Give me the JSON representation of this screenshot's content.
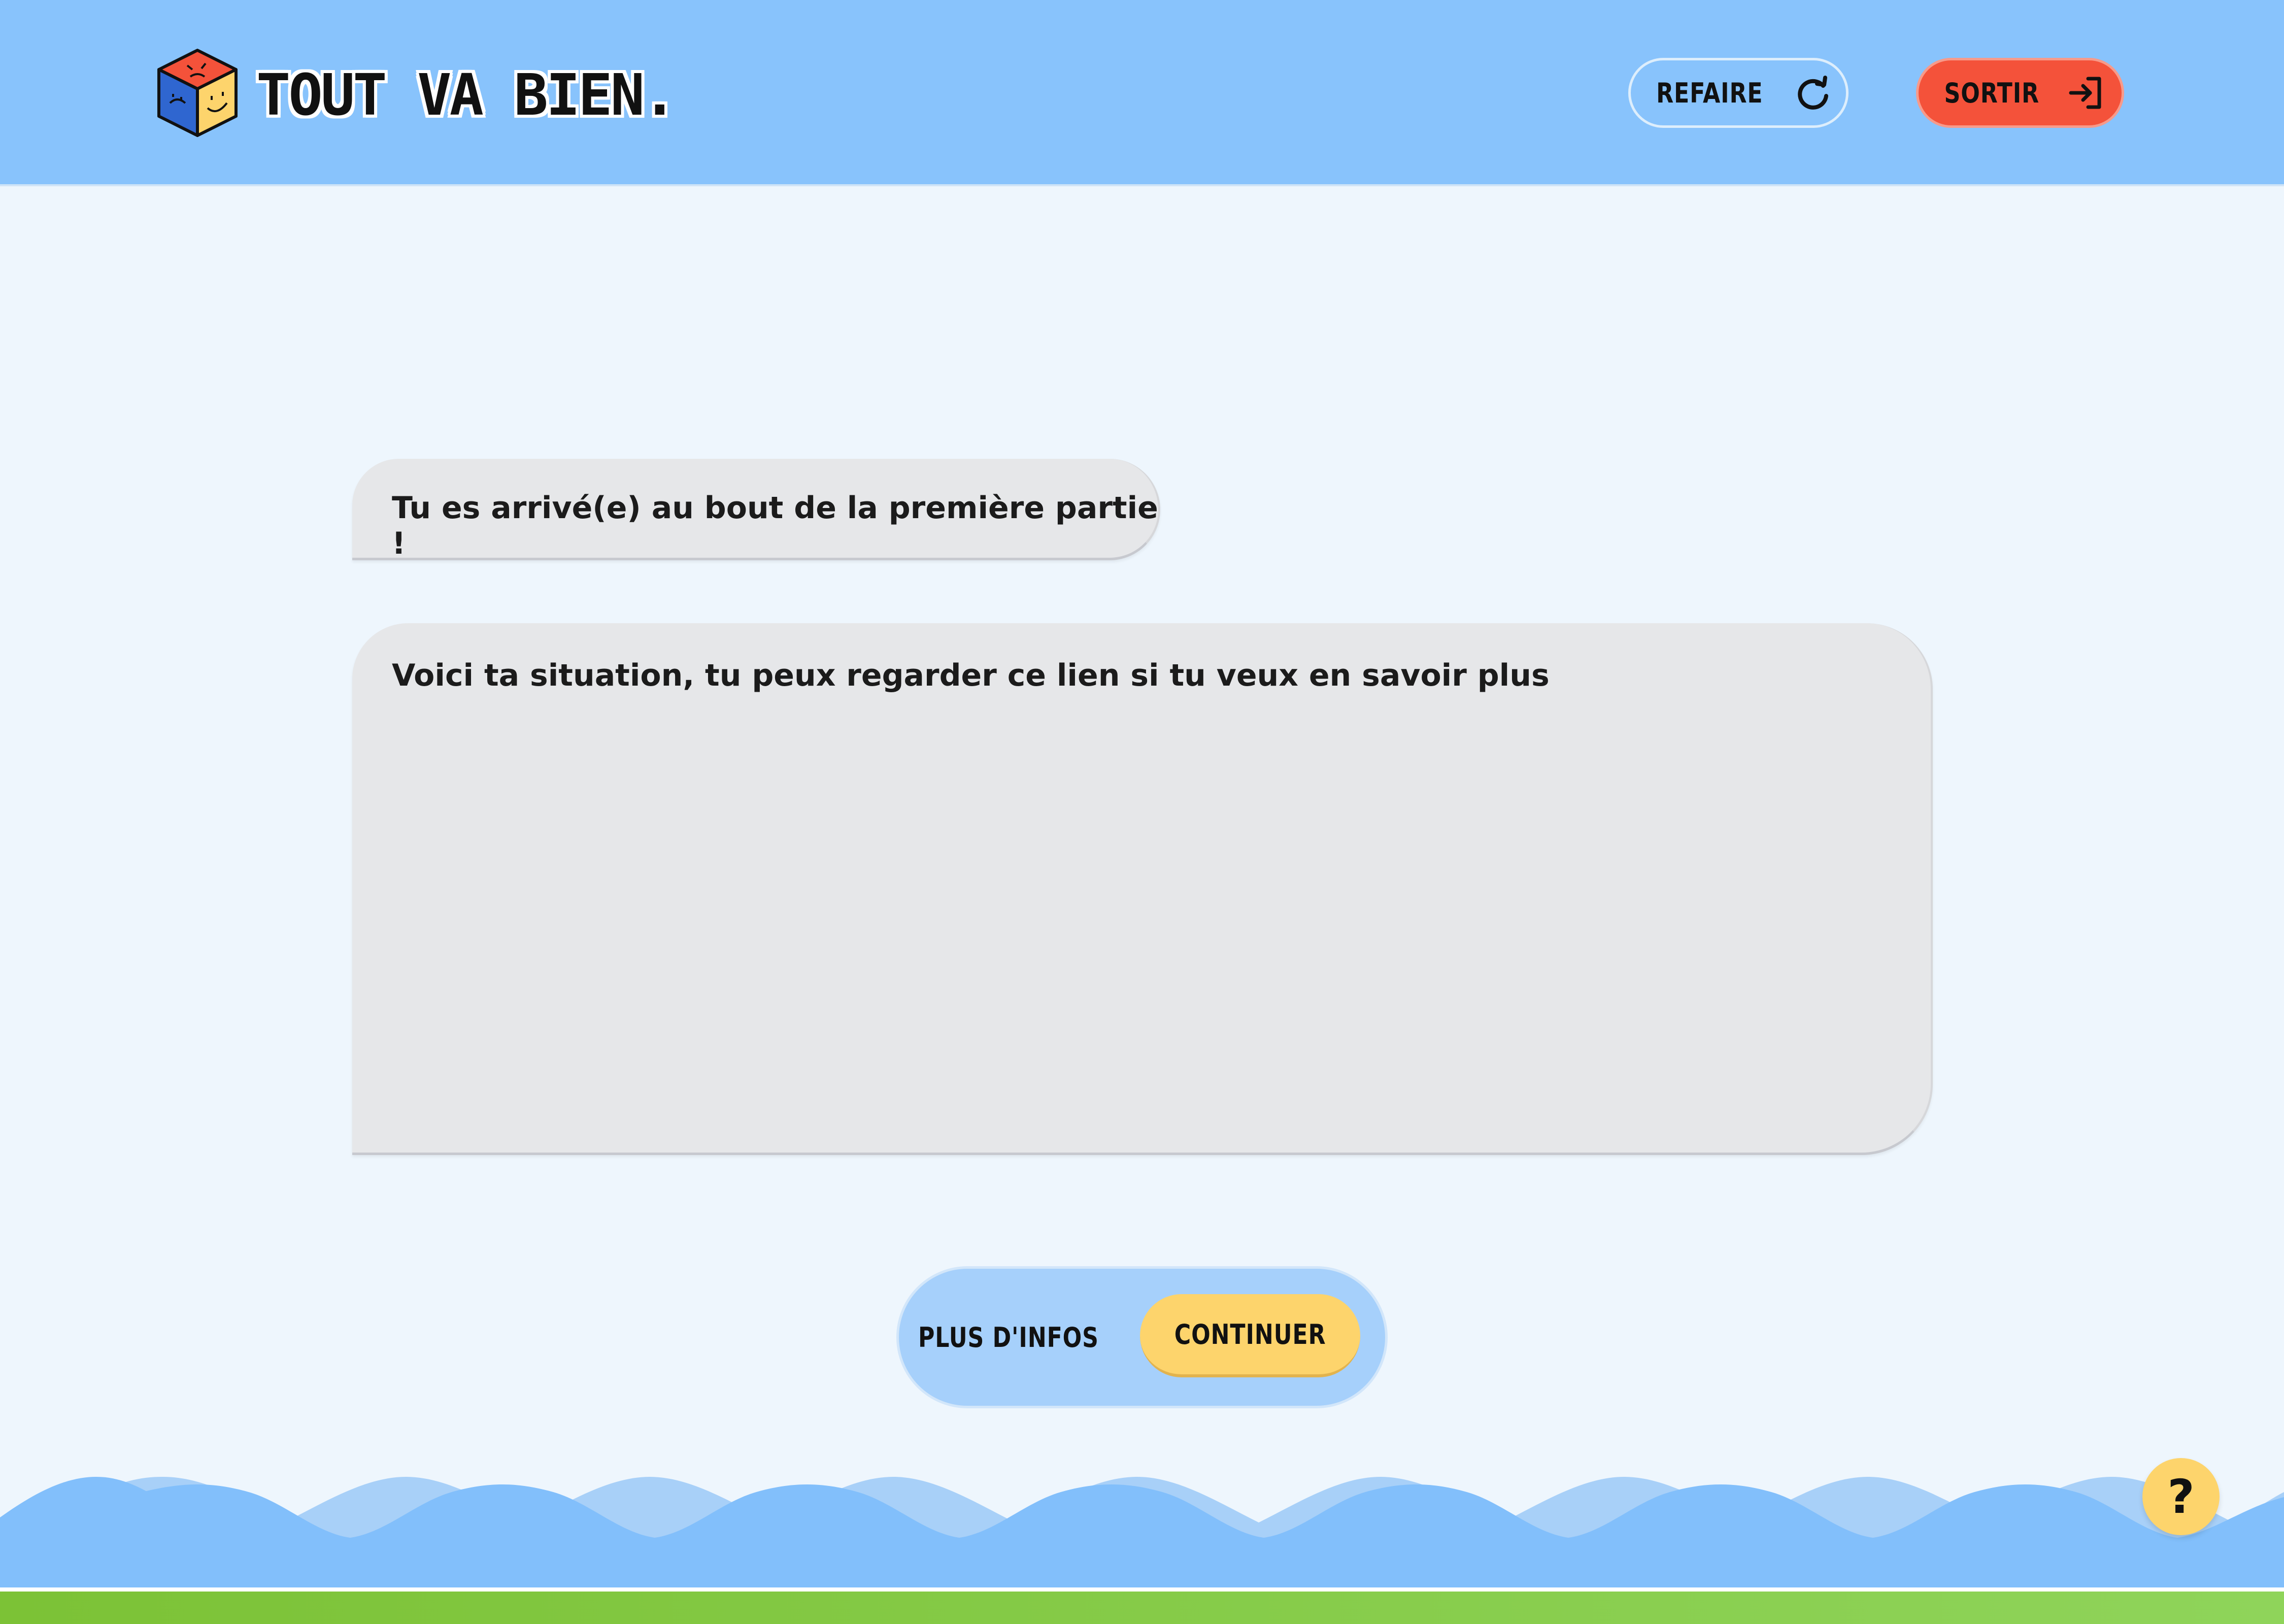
{
  "header": {
    "app_title": "TOUT VA BIEN.",
    "logo_icon": "smiling-frowning-cube-icon",
    "refaire": {
      "label": "REFAIRE",
      "icon": "refresh-icon"
    },
    "sortir": {
      "label": "SORTIR",
      "icon": "exit-arrow-icon"
    }
  },
  "messages": [
    {
      "text": "Tu es arrivé(e) au bout de la première partie !"
    },
    {
      "text": "Voici ta situation, tu peux regarder ce lien si tu veux en savoir plus"
    }
  ],
  "actions": {
    "more_info_label": "PLUS D'INFOS",
    "continue_label": "CONTINUER"
  },
  "help": {
    "label": "?"
  },
  "colors": {
    "header_bg": "#88c3fc",
    "page_bg": "#eef6fd",
    "exit_button": "#f4523a",
    "continue_button": "#fdd46c",
    "bubble_bg": "#e6e7e9",
    "wave_front": "#82bffb",
    "wave_back": "#a8d0f8",
    "ground": "#7cc236"
  }
}
